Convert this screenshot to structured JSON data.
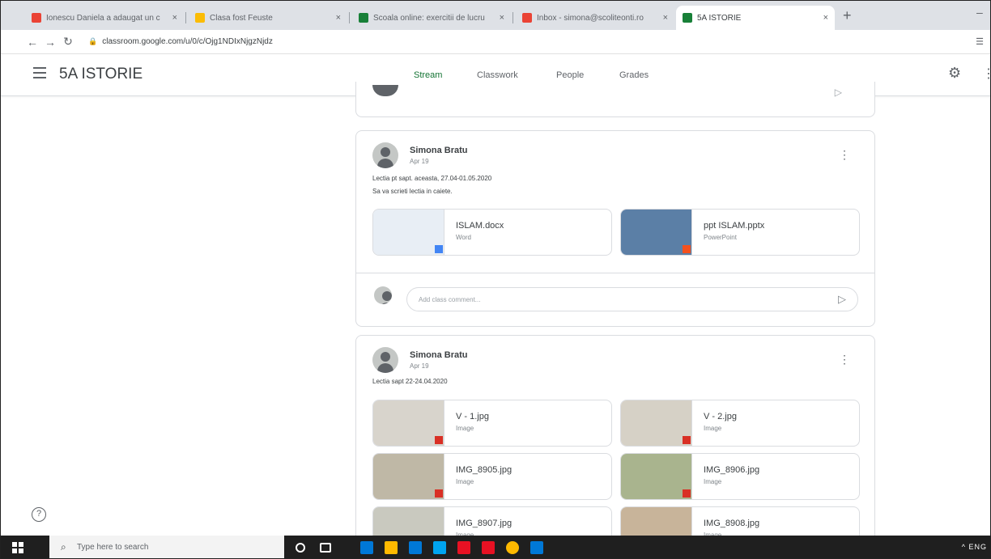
{
  "browser": {
    "tabs": [
      {
        "label": "Ionescu Daniela a adaugat un c",
        "favicon_color": "#ea4335"
      },
      {
        "label": "Clasa fost Feuste",
        "favicon_color": "#fbbc04"
      },
      {
        "label": "Scoala online: exercitii de lucru",
        "favicon_color": "#188038"
      },
      {
        "label": "Inbox - simona@scoliteonti.ro",
        "favicon_color": "#ea4335"
      },
      {
        "label": "5A ISTORIE",
        "favicon_color": "#188038",
        "active": true
      }
    ],
    "new_tab_glyph": "+",
    "url": "classroom.google.com/u/0/c/Ojg1NDIxNjgzNjdz",
    "window_control_glyph": "–",
    "extension_glyph": "☰"
  },
  "header": {
    "class_name": "5A ISTORIE",
    "tabs": [
      "Stream",
      "Classwork",
      "People",
      "Grades"
    ],
    "active_tab": "Stream",
    "accent_color": "#137333"
  },
  "posts": [
    {
      "author": "Simona Bratu",
      "date": "Apr 19",
      "body_lines": [
        "Lectia pt sapt. aceasta, 27.04-01.05.2020",
        "Sa va scrieti lectia in caiete."
      ],
      "attachments": [
        {
          "title": "ISLAM.docx",
          "type": "Word",
          "badge_color": "#4285f4",
          "thumb_color": "#e8eef5"
        },
        {
          "title": "ppt ISLAM.pptx",
          "type": "PowerPoint",
          "badge_color": "#f4511e",
          "thumb_color": "#5b7fa6"
        }
      ],
      "comment_placeholder": "Add class comment..."
    },
    {
      "author": "Simona Bratu",
      "date": "Apr 19",
      "body_lines": [
        "Lectia sapt 22-24.04.2020"
      ],
      "attachments": [
        {
          "title": "V - 1.jpg",
          "type": "Image",
          "badge_color": "#d93025",
          "thumb_color": "#d8d4cc"
        },
        {
          "title": "V - 2.jpg",
          "type": "Image",
          "badge_color": "#d93025",
          "thumb_color": "#d6d1c6"
        },
        {
          "title": "IMG_8905.jpg",
          "type": "Image",
          "badge_color": "#d93025",
          "thumb_color": "#bfb8a6"
        },
        {
          "title": "IMG_8906.jpg",
          "type": "Image",
          "badge_color": "#d93025",
          "thumb_color": "#a9b48e"
        },
        {
          "title": "IMG_8907.jpg",
          "type": "Image",
          "badge_color": "#d93025",
          "thumb_color": "#c9c9bf"
        },
        {
          "title": "IMG_8908.jpg",
          "type": "Image",
          "badge_color": "#d93025",
          "thumb_color": "#c8b49a"
        }
      ]
    }
  ],
  "taskbar": {
    "search_placeholder": "Type here to search",
    "app_icon_colors": [
      "#ffffff",
      "#ffffff",
      "#0078d7",
      "#ffb900",
      "#0078d7",
      "#00a4ef",
      "#e81123",
      "#e81123",
      "#ffb900",
      "#0078d7"
    ],
    "tray_text": "^ ENG"
  }
}
